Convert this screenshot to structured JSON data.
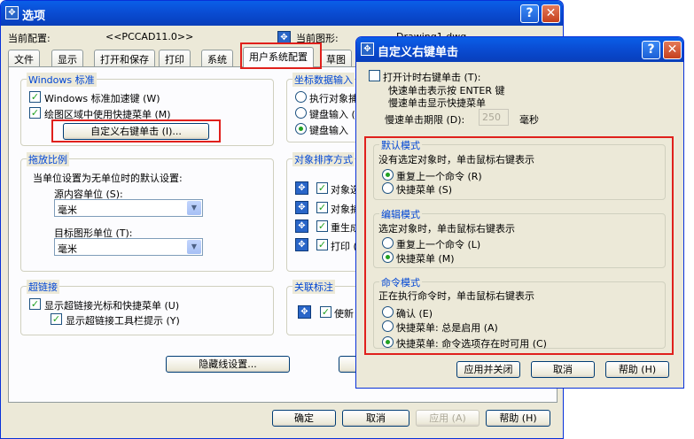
{
  "options": {
    "title": "选项",
    "current_profile_label": "当前配置:",
    "current_profile_value": "<<PCCAD11.0>>",
    "current_drawing_label": "当前图形:",
    "current_drawing_value": "Drawing1.dwg",
    "tabs": [
      "文件",
      "显示",
      "打开和保存",
      "打印",
      "系统",
      "用户系统配置",
      "草图"
    ],
    "windows_std": {
      "title": "Windows 标准",
      "items": [
        "Windows 标准加速键 (W)",
        "绘图区域中使用快捷菜单 (M)"
      ],
      "custom_button": "自定义右键单击 (I)..."
    },
    "drag_scale": {
      "title": "拖放比例",
      "desc": "当单位设置为无单位时的默认设置:",
      "source_label": "源内容单位 (S):",
      "source_value": "毫米",
      "target_label": "目标图形单位 (T):",
      "target_value": "毫米"
    },
    "hyperlink": {
      "title": "超链接",
      "items": [
        "显示超链接光标和快捷菜单 (U)",
        "显示超链接工具栏提示 (Y)"
      ]
    },
    "coord_input": {
      "title": "坐标数据输入",
      "items": [
        "执行对象捕",
        "键盘输入 (",
        "键盘输入"
      ]
    },
    "obj_sort": {
      "title": "对象排序方式",
      "items": [
        "对象选",
        "对象捕",
        "重生成",
        "打印 ("
      ]
    },
    "assoc_dim": {
      "title": "关联标注",
      "item": "使新"
    },
    "hidden_line_button": "隐藏线设置...",
    "buttons": {
      "ok": "确定",
      "cancel": "取消",
      "apply": "应用 (A)",
      "help": "帮助 (H)"
    }
  },
  "custom_right_click": {
    "title": "自定义右键单击",
    "timed_label": "打开计时右键单击 (T):",
    "timed_line1": "快速单击表示按 ENTER 键",
    "timed_line2": "慢速单击显示快捷菜单",
    "duration_label": "慢速单击期限 (D):",
    "duration_value": "250",
    "duration_unit": "毫秒",
    "default_mode": {
      "title": "默认模式",
      "desc": "没有选定对象时，单击鼠标右键表示",
      "options": [
        "重复上一个命令 (R)",
        "快捷菜单 (S)"
      ],
      "selected": 0
    },
    "edit_mode": {
      "title": "编辑模式",
      "desc": "选定对象时，单击鼠标右键表示",
      "options": [
        "重复上一个命令 (L)",
        "快捷菜单 (M)"
      ],
      "selected": 1
    },
    "command_mode": {
      "title": "命令模式",
      "desc": "正在执行命令时，单击鼠标右键表示",
      "options": [
        "确认 (E)",
        "快捷菜单: 总是启用 (A)",
        "快捷菜单: 命令选项存在时可用 (C)"
      ],
      "selected": 2
    },
    "buttons": {
      "apply_close": "应用并关闭",
      "cancel": "取消",
      "help": "帮助 (H)"
    }
  },
  "icons": {
    "app": "cad-app-icon",
    "help": "help-icon",
    "close": "close-icon"
  },
  "colors": {
    "titlebar": "#0a4fd6",
    "group_title": "#0046d5",
    "highlight": "#e0201c"
  }
}
